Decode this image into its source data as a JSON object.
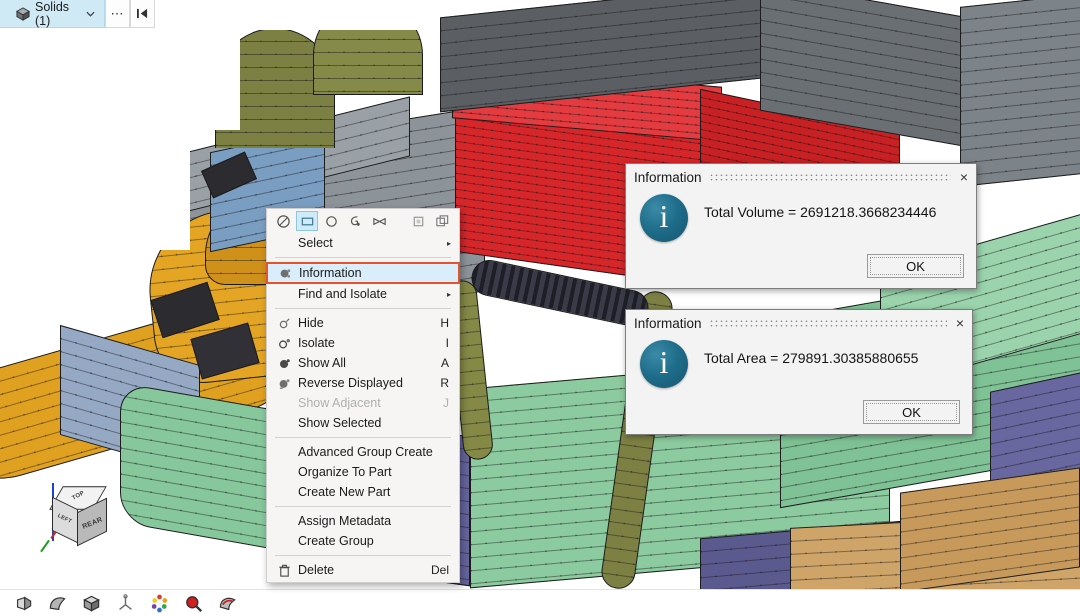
{
  "header": {
    "tab_label": "Solids (1)",
    "tab_icon": "cube-icon",
    "chevron_icon": "chevron-down-icon",
    "more_button_label": "⋯",
    "collapse_button_label": "❘◀"
  },
  "context_menu": {
    "toolbar_icons": [
      {
        "name": "no-select-icon",
        "glyph": "⊘",
        "active": false
      },
      {
        "name": "rectangle-select-icon",
        "glyph": "▭",
        "active": true
      },
      {
        "name": "circle-select-icon",
        "glyph": "○",
        "active": false
      },
      {
        "name": "lasso-select-icon",
        "glyph": "↺",
        "active": false
      },
      {
        "name": "polygon-select-icon",
        "glyph": "⋈",
        "active": false
      },
      {
        "name": "single-face-select-icon",
        "glyph": "□",
        "active": false
      },
      {
        "name": "multi-layer-select-icon",
        "glyph": "❐",
        "active": false
      }
    ],
    "items": [
      {
        "label": "Select",
        "shortcut": "",
        "icon": "",
        "submenu": true,
        "disabled": false,
        "highlighted": false,
        "sep_after": true
      },
      {
        "label": "Information",
        "shortcut": "",
        "icon": "information-icon",
        "submenu": false,
        "disabled": false,
        "highlighted": true,
        "sep_after": false
      },
      {
        "label": "Find and Isolate",
        "shortcut": "",
        "icon": "",
        "submenu": true,
        "disabled": false,
        "highlighted": false,
        "sep_after": true
      },
      {
        "label": "Hide",
        "shortcut": "H",
        "icon": "hide-icon",
        "submenu": false,
        "disabled": false,
        "highlighted": false,
        "sep_after": false
      },
      {
        "label": "Isolate",
        "shortcut": "I",
        "icon": "isolate-icon",
        "submenu": false,
        "disabled": false,
        "highlighted": false,
        "sep_after": false
      },
      {
        "label": "Show All",
        "shortcut": "A",
        "icon": "show-all-icon",
        "submenu": false,
        "disabled": false,
        "highlighted": false,
        "sep_after": false
      },
      {
        "label": "Reverse Displayed",
        "shortcut": "R",
        "icon": "reverse-displayed-icon",
        "submenu": false,
        "disabled": false,
        "highlighted": false,
        "sep_after": false
      },
      {
        "label": "Show Adjacent",
        "shortcut": "J",
        "icon": "",
        "submenu": false,
        "disabled": true,
        "highlighted": false,
        "sep_after": false
      },
      {
        "label": "Show Selected",
        "shortcut": "",
        "icon": "",
        "submenu": false,
        "disabled": false,
        "highlighted": false,
        "sep_after": true
      },
      {
        "label": "Advanced Group Create",
        "shortcut": "",
        "icon": "",
        "submenu": false,
        "disabled": false,
        "highlighted": false,
        "sep_after": false
      },
      {
        "label": "Organize To Part",
        "shortcut": "",
        "icon": "",
        "submenu": false,
        "disabled": false,
        "highlighted": false,
        "sep_after": false
      },
      {
        "label": "Create New Part",
        "shortcut": "",
        "icon": "",
        "submenu": false,
        "disabled": false,
        "highlighted": false,
        "sep_after": true
      },
      {
        "label": "Assign Metadata",
        "shortcut": "",
        "icon": "",
        "submenu": false,
        "disabled": false,
        "highlighted": false,
        "sep_after": false
      },
      {
        "label": "Create Group",
        "shortcut": "",
        "icon": "",
        "submenu": false,
        "disabled": false,
        "highlighted": false,
        "sep_after": true
      },
      {
        "label": "Delete",
        "shortcut": "Del",
        "icon": "trash-icon",
        "submenu": false,
        "disabled": false,
        "highlighted": false,
        "sep_after": false
      }
    ]
  },
  "dialogs": [
    {
      "title": "Information",
      "message": "Total Volume = 2691218.3668234446",
      "ok_label": "OK",
      "close_label": "×",
      "icon": "information-dialog-icon"
    },
    {
      "title": "Information",
      "message": "Total Area = 279891.30385880655",
      "ok_label": "OK",
      "close_label": "×",
      "icon": "information-dialog-icon"
    }
  ],
  "nav_cube": {
    "top_label": "TOP",
    "left_label": "LEFT",
    "right_label": "REAR"
  },
  "bottom_toolbar": {
    "icons": [
      {
        "name": "render-view-icon",
        "glyph": "◷"
      },
      {
        "name": "surface-shading-icon",
        "glyph": "◖"
      },
      {
        "name": "cube-view-icon",
        "glyph": "❐"
      },
      {
        "name": "axis-tripod-icon",
        "glyph": "⑂"
      },
      {
        "name": "color-wheel-icon",
        "glyph": "✵"
      },
      {
        "name": "zoom-magnifier-icon",
        "glyph": "⚲"
      },
      {
        "name": "section-cut-icon",
        "glyph": "◑"
      }
    ]
  },
  "colors": {
    "accent_highlight": "#e4532c",
    "tab_background": "#cfeaf5",
    "menu_highlight_fill": "#d9eefa",
    "info_icon": "#1e6e8c",
    "mesh_orange": "#e0a020",
    "mesh_red": "#d6262a",
    "mesh_green": "#86c79b",
    "mesh_grey": "#8d9499",
    "mesh_olive": "#7d8043",
    "mesh_purple": "#5b5a8f",
    "mesh_tan": "#cfa468",
    "mesh_blue": "#7a9ec2"
  }
}
